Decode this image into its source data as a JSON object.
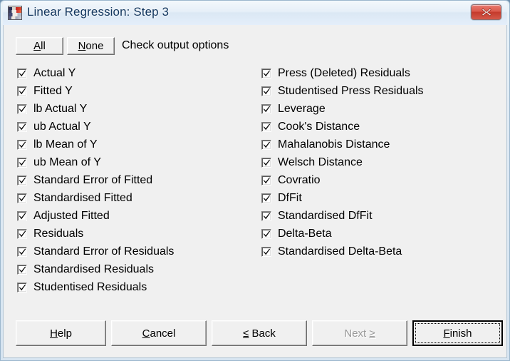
{
  "window": {
    "title": "Linear Regression: Step 3",
    "icon": "app-chart-icon",
    "close_label": "Close",
    "accent_close": "#c43a2c",
    "title_color": "#12365e",
    "dialog_bg": "#f0f0f0"
  },
  "toolbar": {
    "all_label": "All",
    "all_accel": "A",
    "none_label": "None",
    "none_accel": "N",
    "instruction": "Check output options"
  },
  "options": {
    "left": [
      {
        "label": "Actual Y",
        "checked": true
      },
      {
        "label": "Fitted Y",
        "checked": true
      },
      {
        "label": "lb Actual Y",
        "checked": true
      },
      {
        "label": "ub Actual Y",
        "checked": true
      },
      {
        "label": "lb Mean of Y",
        "checked": true
      },
      {
        "label": "ub Mean of Y",
        "checked": true
      },
      {
        "label": "Standard Error of Fitted",
        "checked": true
      },
      {
        "label": "Standardised Fitted",
        "checked": true
      },
      {
        "label": "Adjusted Fitted",
        "checked": true
      },
      {
        "label": "Residuals",
        "checked": true
      },
      {
        "label": "Standard Error of Residuals",
        "checked": true
      },
      {
        "label": "Standardised Residuals",
        "checked": true
      },
      {
        "label": "Studentised Residuals",
        "checked": true
      }
    ],
    "right": [
      {
        "label": "Press (Deleted) Residuals",
        "checked": true
      },
      {
        "label": "Studentised Press Residuals",
        "checked": true
      },
      {
        "label": "Leverage",
        "checked": true
      },
      {
        "label": "Cook's Distance",
        "checked": true
      },
      {
        "label": "Mahalanobis Distance",
        "checked": true
      },
      {
        "label": "Welsch Distance",
        "checked": true
      },
      {
        "label": "Covratio",
        "checked": true
      },
      {
        "label": "DfFit",
        "checked": true
      },
      {
        "label": "Standardised DfFit",
        "checked": true
      },
      {
        "label": "Delta-Beta",
        "checked": true
      },
      {
        "label": "Standardised Delta-Beta",
        "checked": true
      }
    ]
  },
  "footer": {
    "help": {
      "pre": "",
      "accel": "H",
      "post": "elp",
      "enabled": true,
      "default": false
    },
    "cancel": {
      "pre": "",
      "accel": "C",
      "post": "ancel",
      "enabled": true,
      "default": false
    },
    "back": {
      "pre": "",
      "accel": "≤",
      "post": " Back",
      "enabled": true,
      "default": false
    },
    "next": {
      "pre": "Next ",
      "accel": "≥",
      "post": "",
      "enabled": false,
      "default": false
    },
    "finish": {
      "pre": "",
      "accel": "F",
      "post": "inish",
      "enabled": true,
      "default": true
    }
  }
}
